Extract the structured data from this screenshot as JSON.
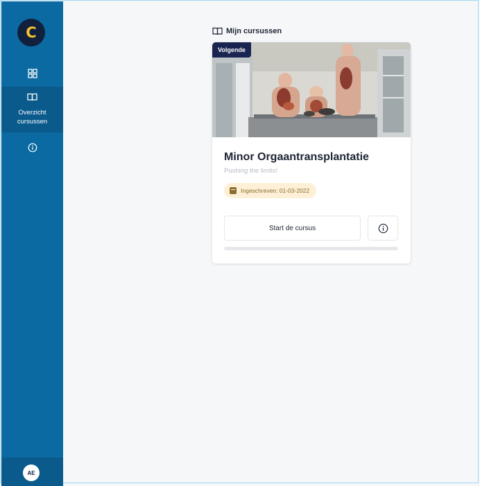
{
  "sidebar": {
    "logo_letter": "C",
    "nav": [
      {
        "icon": "dashboard-icon"
      },
      {
        "icon": "book-icon",
        "label_line1": "Overzicht",
        "label_line2": "cursussen",
        "active": true
      },
      {
        "icon": "info-icon"
      }
    ],
    "avatar_initials": "AE"
  },
  "main": {
    "heading": "Mijn cursussen"
  },
  "course": {
    "badge": "Volgende",
    "title": "Minor Orgaantransplantatie",
    "subtitle": "Pushing the limits!",
    "enrolled": "Ingeschreven: 01-03-2022",
    "start_label": "Start de cursus",
    "progress_fraction": 0
  },
  "colors": {
    "sidebar": "#0b6aa2",
    "accent": "#f2c530",
    "badge": "#1a2450"
  }
}
